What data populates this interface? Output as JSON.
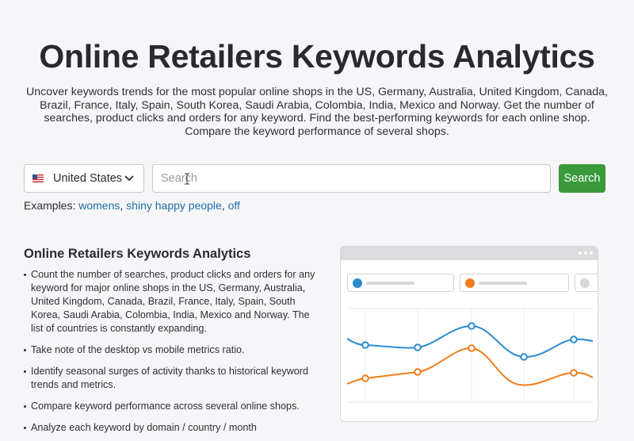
{
  "header": {
    "title": "Online Retailers Keywords Analytics",
    "intro": "Uncover keywords trends for the most popular online shops in the US, Germany, Australia, United Kingdom, Canada, Brazil, France, Italy, Spain, South Korea, Saudi Arabia, Colombia, India, Mexico and Norway. Get the number of searches, product clicks and orders for any keyword. Find the best-performing keywords for each online shop. Compare the keyword performance of several shops."
  },
  "search": {
    "country": "United States",
    "flag_icon": "us-flag-icon",
    "placeholder": "Search",
    "value": "",
    "button_label": "Search",
    "button_color": "#3a9a3a",
    "examples_label": "Examples:",
    "examples": [
      "womens",
      "shiny happy people",
      "off"
    ]
  },
  "features": {
    "title": "Online Retailers Keywords Analytics",
    "items": [
      "Count the number of searches, product clicks and orders for any keyword for major online shops in the US, Germany, Australia, United Kingdom, Canada, Brazil, France, Italy, Spain, South Korea, Saudi Arabia, Colombia, India, Mexico and Norway. The list of countries is constantly expanding.",
      "Take note of the desktop vs mobile metrics ratio.",
      "Identify seasonal surges of activity thanks to historical keyword trends and metrics.",
      "Compare keyword performance across several online shops.",
      "Analyze each keyword by domain / country / month"
    ]
  },
  "illustration": {
    "series_colors": [
      "#2b8bd1",
      "#ee7d1a",
      "#d9d9dd"
    ]
  }
}
